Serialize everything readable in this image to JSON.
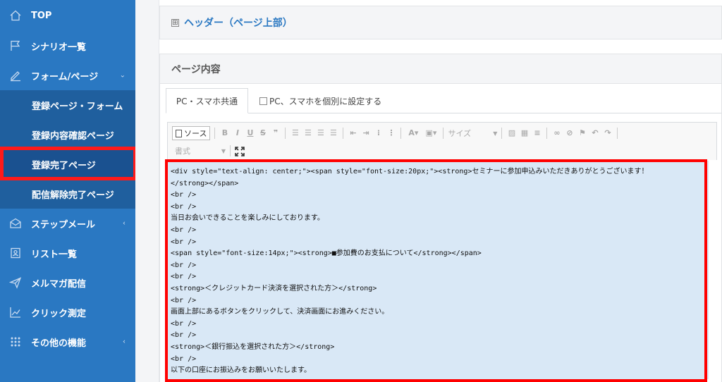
{
  "sidebar": {
    "items": [
      {
        "label": "TOP",
        "icon": "home-icon"
      },
      {
        "label": "シナリオ一覧",
        "icon": "flag-icon"
      },
      {
        "label": "フォーム/ページ",
        "icon": "pen-icon",
        "caret": "⌄"
      },
      {
        "label": "登録ページ・フォーム"
      },
      {
        "label": "登録内容確認ページ"
      },
      {
        "label": "登録完了ページ"
      },
      {
        "label": "配信解除完了ページ"
      },
      {
        "label": "ステップメール",
        "icon": "envelope-icon",
        "caret": "‹"
      },
      {
        "label": "リスト一覧",
        "icon": "contact-list-icon"
      },
      {
        "label": "メルマガ配信",
        "icon": "send-icon"
      },
      {
        "label": "クリック測定",
        "icon": "chart-line-icon"
      },
      {
        "label": "その他の機能",
        "icon": "grid-dots-icon",
        "caret": "‹"
      }
    ]
  },
  "header_panel": {
    "expand_symbol": "⊞",
    "title": "ヘッダー（ページ上部）"
  },
  "content_panel": {
    "title": "ページ内容",
    "tab_active": "PC・スマホ共通",
    "checkbox_label": "PC、スマホを個別に設定する"
  },
  "toolbar": {
    "source_label": "ソース",
    "size_label": "サイズ",
    "format_label": "書式"
  },
  "editor": {
    "lines": [
      "<div style=\"text-align: center;\"><span style=\"font-size:20px;\"><strong>セミナーに参加申込みいただきありがとうございます！",
      "</strong></span>",
      "<br />",
      "<br />",
      "当日お会いできることを楽しみにしております。",
      "<br />",
      "<br />",
      "<span style=\"font-size:14px;\"><strong>■参加費のお支払について</strong></span>",
      "<br />",
      "<br />",
      "<strong>＜クレジットカード決済を選択された方＞</strong>",
      "<br />",
      "画面上部にあるボタンをクリックして、決済画面にお進みください。",
      "<br />",
      "<br />",
      "<strong>＜銀行振込を選択された方＞</strong>",
      "<br />",
      "以下の口座にお振込みをお願いいたします。"
    ]
  },
  "colors": {
    "sidebar": "#2a78c2",
    "highlight": "#ff0000",
    "editor_bg": "#d9e8f6"
  }
}
